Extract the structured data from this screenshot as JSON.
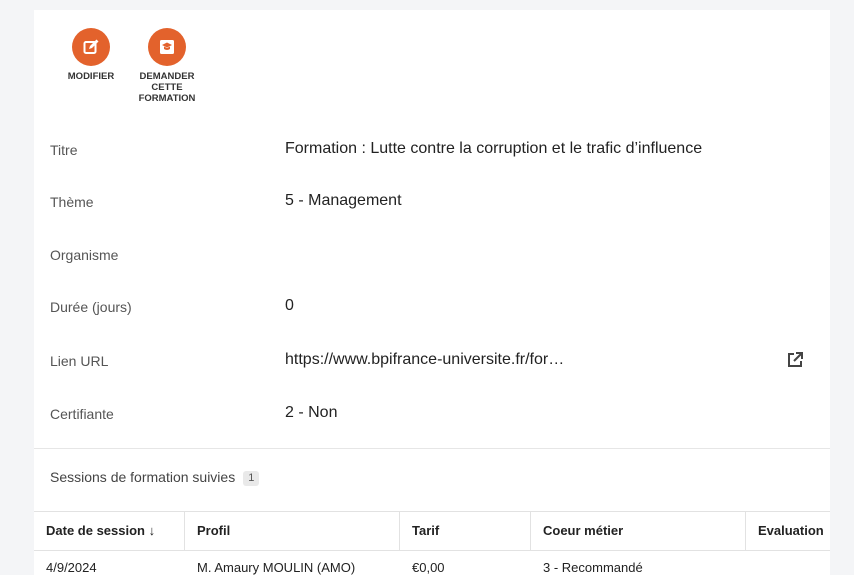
{
  "actions": {
    "modifier_label": "MODIFIER",
    "demander_label": "DEMANDER\nCETTE\nFORMATION",
    "accent_color": "#e3622c"
  },
  "fields": {
    "titre": {
      "label": "Titre",
      "value": "Formation : Lutte contre la corruption et le trafic d’influence"
    },
    "theme": {
      "label": "Thème",
      "value": "5 - Management"
    },
    "organisme": {
      "label": "Organisme",
      "value": ""
    },
    "duree": {
      "label": "Durée (jours)",
      "value": "0"
    },
    "lien": {
      "label": "Lien URL",
      "value": "https://www.bpifrance-universite.fr/for…",
      "icon": "external-link-icon"
    },
    "certifiante": {
      "label": "Certifiante",
      "value": "2 - Non"
    }
  },
  "sessions": {
    "title": "Sessions de formation suivies",
    "count": "1",
    "columns": [
      "Date de session ↓",
      "Profil",
      "Tarif",
      "Coeur métier",
      "Evaluation"
    ],
    "rows": [
      [
        "4/9/2024",
        "M. Amaury MOULIN (AMO)",
        "€0,00",
        "3 - Recommandé",
        ""
      ]
    ]
  }
}
